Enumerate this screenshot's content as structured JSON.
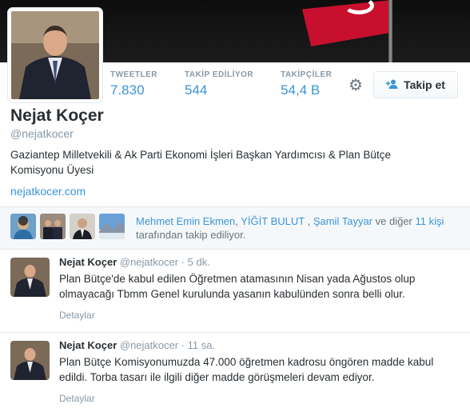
{
  "profile": {
    "name": "Nejat Koçer",
    "handle": "@nejatkocer",
    "bio": "Gaziantep Milletvekili & Ak Parti Ekonomi İşleri Başkan Yardımcısı & Plan Bütçe Komisyonu Üyesi",
    "url": "nejatkocer.com"
  },
  "stats": [
    {
      "label": "TWEETLER",
      "value": "7.830"
    },
    {
      "label": "TAKİP EDİLİYOR",
      "value": "544"
    },
    {
      "label": "TAKİPÇİLER",
      "value": "54,4 B"
    }
  ],
  "actions": {
    "follow_label": "Takip et",
    "settings_icon": "gear-icon",
    "follow_icon": "add-user-icon"
  },
  "followers_you_know": {
    "names": [
      "Mehmet Emin Ekmen",
      "YİĞİT BULUT",
      "Şamil Tayyar"
    ],
    "sep1": ", ",
    "sep2": " , ",
    "and_others": " ve diğer ",
    "count_link": "11 kişi",
    "suffix": "tarafından takip ediliyor."
  },
  "tweets": [
    {
      "name": "Nejat Koçer",
      "handle": "@nejatkocer",
      "time": "· 5 dk.",
      "text": "Plan Bütçe'de kabul edilen Öğretmen atamasının Nisan yada Ağustos olup olmayacağı Tbmm Genel kurulunda yasanın kabulünden sonra belli olur.",
      "details": "Detaylar"
    },
    {
      "name": "Nejat Koçer",
      "handle": "@nejatkocer",
      "time": "· 11 sa.",
      "text": "Plan Bütçe Komisyonumuzda 47.000 öğretmen kadrosu öngören madde kabul edildi. Torba tasarı ile ilgili diğer madde görüşmeleri devam ediyor.",
      "details": "Detaylar"
    }
  ],
  "colors": {
    "link": "#3b94d9",
    "muted": "#8899a6",
    "text": "#292f33"
  }
}
